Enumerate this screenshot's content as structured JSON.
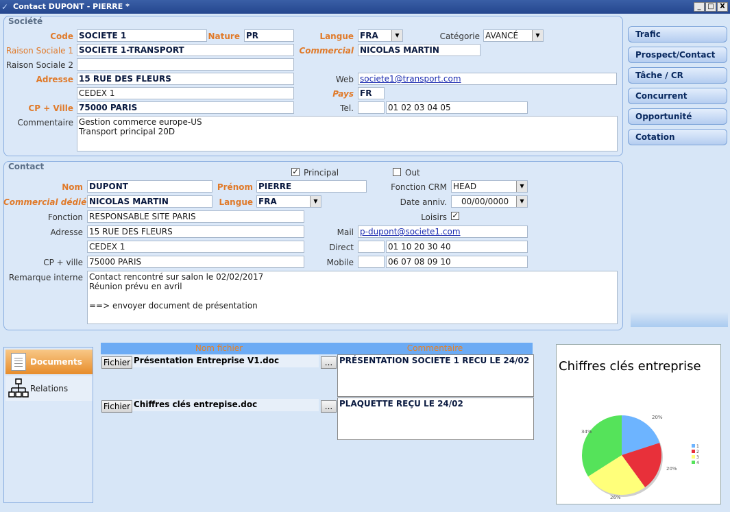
{
  "window": {
    "title": "Contact DUPONT - PIERRE *",
    "buttons": {
      "minimize": "_",
      "maximize": "□",
      "close": "X"
    }
  },
  "societe": {
    "legend": "Société",
    "code_label": "Code",
    "code_value": "SOCIETE 1",
    "nature_label": "Nature",
    "nature_value": "PR",
    "langue_label": "Langue",
    "langue_value": "FRA",
    "categorie_label": "Catégorie",
    "categorie_value": "AVANCÉ",
    "raison1_label": "Raison Sociale 1",
    "raison1_value": "SOCIETE 1-TRANSPORT",
    "commercial_label": "Commercial",
    "commercial_value": "NICOLAS MARTIN",
    "raison2_label": "Raison Sociale 2",
    "raison2_value": "",
    "adresse_label": "Adresse",
    "adresse1_value": "15 RUE DES FLEURS",
    "adresse2_value": "CEDEX 1",
    "web_label": "Web",
    "web_value": "societe1@transport.com",
    "pays_label": "Pays",
    "pays_value": "FR",
    "cpville_label": "CP + Ville",
    "cpville_value": "75000 PARIS",
    "tel_label": "Tel.",
    "tel_prefix": "",
    "tel_value": "01 02 03 04 05",
    "commentaire_label": "Commentaire",
    "commentaire_value": "Gestion commerce europe-US\nTransport principal 20D"
  },
  "contact": {
    "legend": "Contact",
    "principal_label": "Principal",
    "principal_checked": "✓",
    "out_label": "Out",
    "out_checked": "",
    "nom_label": "Nom",
    "nom_value": "DUPONT",
    "prenom_label": "Prénom",
    "prenom_value": "PIERRE",
    "fonction_crm_label": "Fonction CRM",
    "fonction_crm_value": "HEAD",
    "commercial_label": "Commercial dédié",
    "commercial_value": "NICOLAS MARTIN",
    "langue_label": "Langue",
    "langue_value": "FRA",
    "date_label": "Date anniv.",
    "date_value": "00/00/0000",
    "fonction_label": "Fonction",
    "fonction_value": "RESPONSABLE SITE PARIS",
    "loisirs_label": "Loisirs",
    "loisirs_checked": "✓",
    "adresse_label": "Adresse",
    "adresse1_value": "15 RUE DES FLEURS",
    "adresse2_value": "CEDEX 1",
    "mail_label": "Mail",
    "mail_value": "p-dupont@societe1.com",
    "direct_label": "Direct",
    "direct_prefix": "",
    "direct_value": "01 10 20 30 40",
    "cpville_label": "CP + ville",
    "cpville_value": "75000 PARIS",
    "mobile_label": "Mobile",
    "mobile_prefix": "",
    "mobile_value": "06 07 08 09 10",
    "remarque_label": "Remarque interne",
    "remarque_value": "Contact rencontré sur salon le 02/02/2017\nRéunion prévu en avril\n\n==> envoyer document de présentation"
  },
  "side_buttons": [
    "Trafic",
    "Prospect/Contact",
    "Tâche / CR",
    "Concurrent",
    "Opportunité",
    "Cotation"
  ],
  "nav": {
    "documents": "Documents",
    "relations": "Relations"
  },
  "documents": {
    "col_nom": "Nom fichier",
    "col_commentaire": "Commentaire",
    "fichier_button": "Fichier",
    "browse_button": "...",
    "rows": [
      {
        "nom": "Présentation Entreprise V1.doc",
        "commentaire": "PRÉSENTATION SOCIETE 1 RECU LE 24/02"
      },
      {
        "nom": "Chiffres clés entrepise.doc",
        "commentaire": "PLAQUETTE REÇU LE 24/02"
      }
    ]
  },
  "chart_data": {
    "type": "pie",
    "title": "Chiffres clés entreprise",
    "categories": [
      "1",
      "2",
      "3",
      "4"
    ],
    "values": [
      20,
      20,
      26,
      34
    ],
    "labels": [
      "20%",
      "20%",
      "26%",
      "34%"
    ],
    "colors": [
      "#6db4ff",
      "#e8303a",
      "#ffff7a",
      "#55e35a"
    ],
    "legend_position": "right"
  }
}
